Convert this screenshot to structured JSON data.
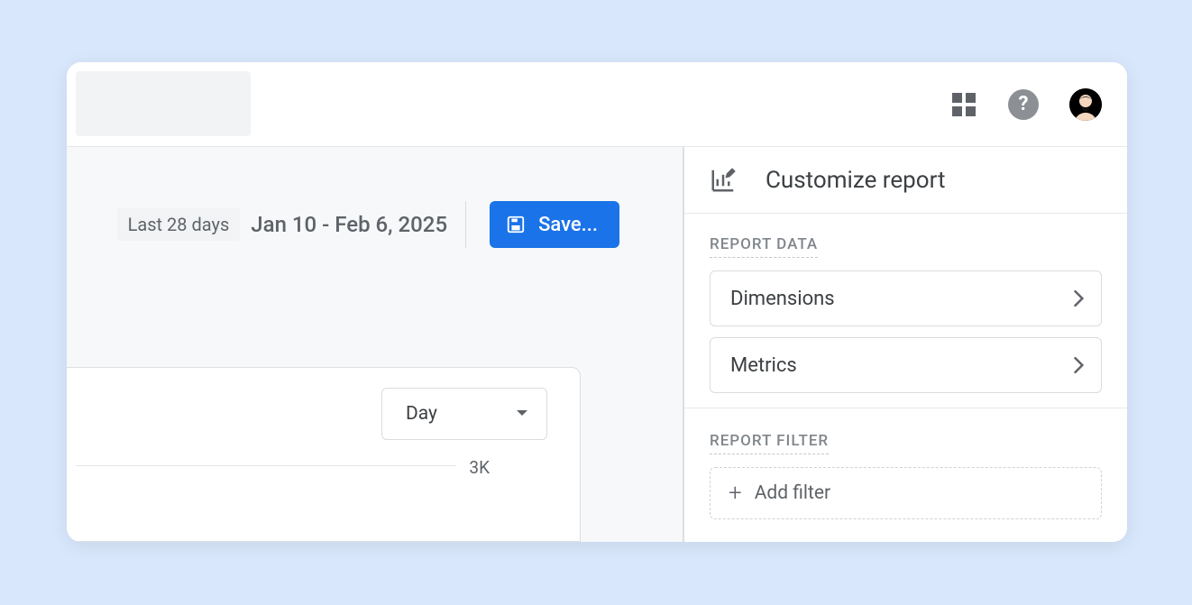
{
  "topbar": {},
  "toolbar": {
    "range_chip": "Last 28 days",
    "date_range": "Jan 10 - Feb 6, 2025",
    "save_label": "Save..."
  },
  "chart_card": {
    "granularity_selected": "Day",
    "axis_tick_top": "3K"
  },
  "panel": {
    "title": "Customize report",
    "section_data": "REPORT DATA",
    "dimensions": "Dimensions",
    "metrics": "Metrics",
    "section_filter": "REPORT FILTER",
    "add_filter": "Add filter"
  }
}
